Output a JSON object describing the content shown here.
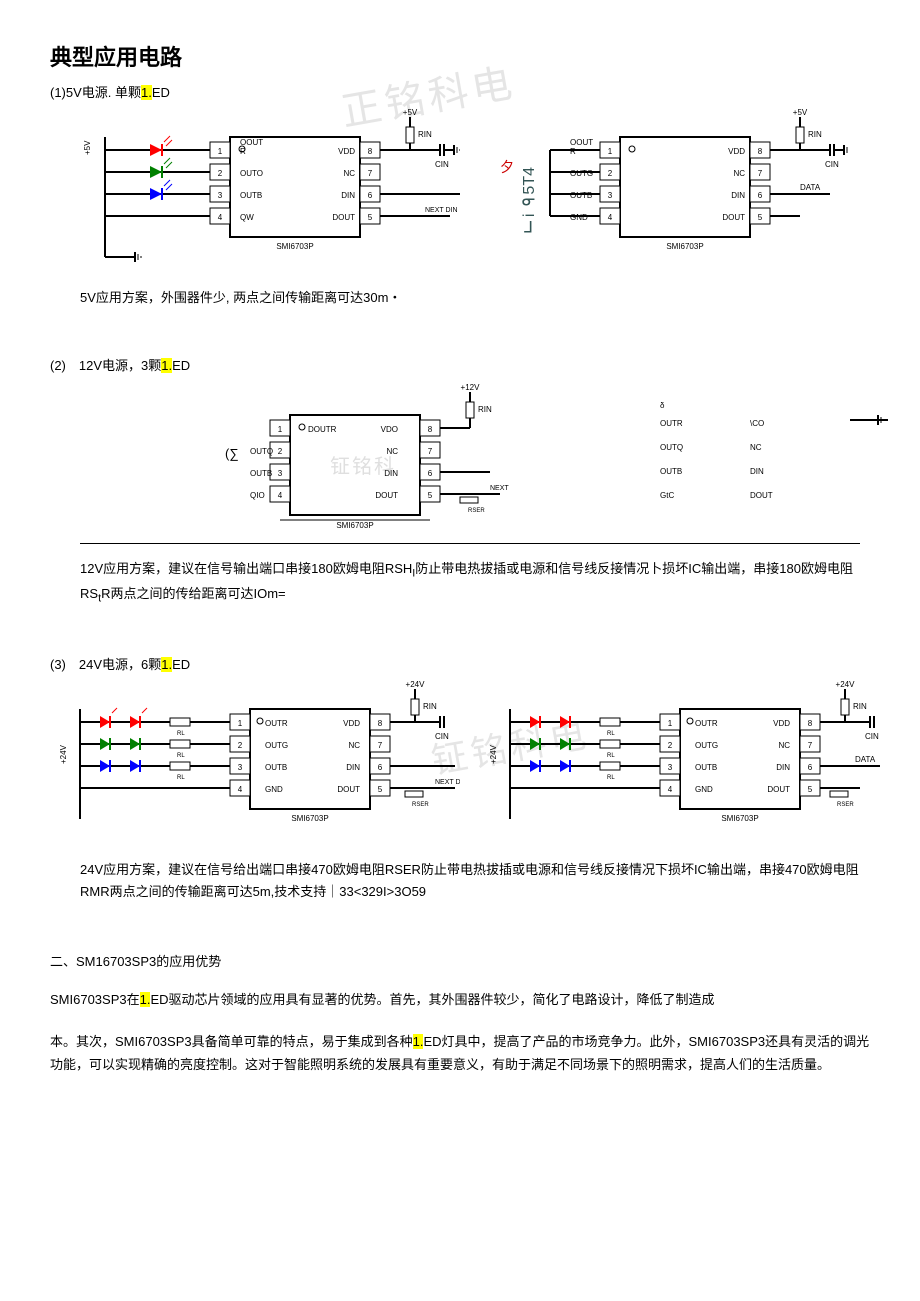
{
  "title": "典型应用电路",
  "section1": {
    "label_prefix": "(1)5V电源. 单颗",
    "hl": "1.",
    "label_suffix": "ED",
    "desc": "5V应用方案，外围器件少, 两点之间传输距离可达30m・"
  },
  "section2": {
    "label_prefix": "(2)　12V电源，3颗",
    "hl": "1.",
    "label_suffix": "ED",
    "desc_a": "12V应用方案，建议在信号输出端口串接180欧姆电阻RSH",
    "desc_sub1": "I",
    "desc_b": "防止带电热拔插或电源和信号线反接情况卜损坏IC输出端，串接180欧姆电阻RS",
    "desc_sub2": "t",
    "desc_c": "R两点之间的传给距离可达IOm="
  },
  "section3": {
    "label_prefix": "(3)　24V电源，6颗",
    "hl": "1.",
    "label_suffix": "ED",
    "desc": "24V应用方案，建议在信号给出端口串接470欧姆电阻RSER防止带电热拔插或电源和信号线反接情况下损坏IC输出端，串接470欧姆电阻RMR两点之间的传输距离可达5m,技术支持｜33<329I>3O59"
  },
  "advantages": {
    "heading": "二、SM16703SP3的应用优势",
    "p1a": "SMI6703SP3在",
    "p1hl": "1.",
    "p1b": "ED驱动芯片领域的应用具有显著的优势。首先，其外围器件较少，简化了电路设计，降低了制造成",
    "p2a": "本。其次，SMI6703SP3具备简单可靠的特点，易于集成到各种",
    "p2hl": "1.",
    "p2b": "ED灯具中，提高了产品的市场竞争力。此外，SMI6703SP3还具有灵活的调光功能，可以实现精确的亮度控制。这对于智能照明系统的发展具有重要意义，有助于满足不同场景下的照明需求，提高人们的生活质量。"
  },
  "chip": {
    "name": "SMI6703P",
    "pins_left_a": [
      "OOUTR",
      "OUTO",
      "OUTB",
      "QW"
    ],
    "pins_left_b": [
      "OOUTR",
      "OUTG",
      "OUTB",
      "GND"
    ],
    "pins_right": [
      "VDD",
      "NC",
      "DIN",
      "DOUT"
    ],
    "pin_nums_left": [
      "1",
      "2",
      "3",
      "4"
    ],
    "pin_nums_right": [
      "8",
      "7",
      "6",
      "5"
    ],
    "v5": "+5V",
    "v12": "+12V",
    "v24": "+24V",
    "rin": "RIN",
    "cin": "CIN",
    "data": "DATA",
    "nextdin": "NEXT DIN",
    "rser": "RSER",
    "outr": "OUTR",
    "outg": "OUTG",
    "outb": "OUTB",
    "gnd": "GND",
    "doutr": "DOUTR",
    "vdo": "VDO",
    "outq": "OUTQ",
    "qio": "QIO",
    "d_outr": "OUTR",
    "d_vco": "\\CO",
    "d_outq": "OUTQ",
    "d_nc": "NC",
    "d_outb": "OUTB",
    "d_din": "DIN",
    "d_gtc": "GtC",
    "d_dout": "DOUT",
    "rl": "RL",
    "delta": "δ"
  },
  "stray": {
    "xi": "夕",
    "glyph": "ᒥiᓄ5T4",
    "sigma": "(∑",
    "wm1": "正铭科电",
    "wm2": "钲铭科电"
  }
}
